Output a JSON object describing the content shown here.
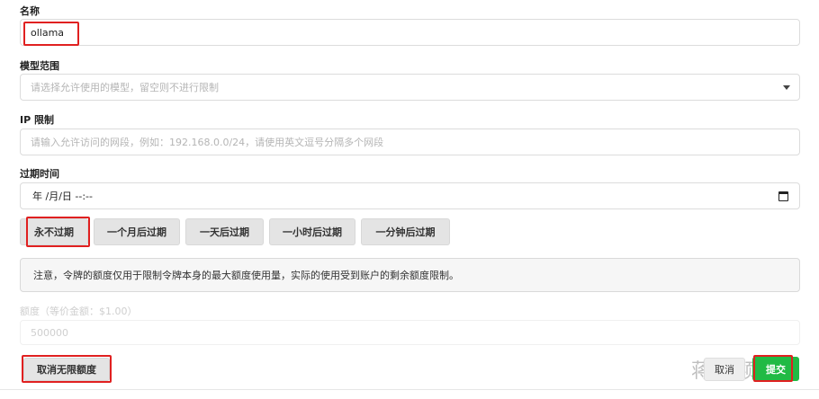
{
  "name_field": {
    "label": "名称",
    "value": "ollama"
  },
  "model_scope": {
    "label": "模型范围",
    "placeholder": "请选择允许使用的模型，留空则不进行限制"
  },
  "ip_limit": {
    "label": "IP 限制",
    "placeholder": "请输入允许访问的网段，例如：192.168.0.0/24，请使用英文逗号分隔多个网段"
  },
  "expiry": {
    "label": "过期时间",
    "value": "年 /月/日 --:--",
    "options": [
      "永不过期",
      "一个月后过期",
      "一天后过期",
      "一小时后过期",
      "一分钟后过期"
    ]
  },
  "notice": {
    "text": "注意，令牌的额度仅用于限制令牌本身的最大额度使用量，实际的使用受到账户的剩余额度限制。"
  },
  "quota": {
    "label": "额度（等价金额：$1.00）",
    "value": "500000"
  },
  "actions": {
    "cancel_unlimited": "取消无限额度",
    "cancel": "取消",
    "submit": "提交"
  },
  "watermark": "蒋小颖记",
  "colors": {
    "submit": "#21ba45",
    "highlight": "#e02020"
  }
}
